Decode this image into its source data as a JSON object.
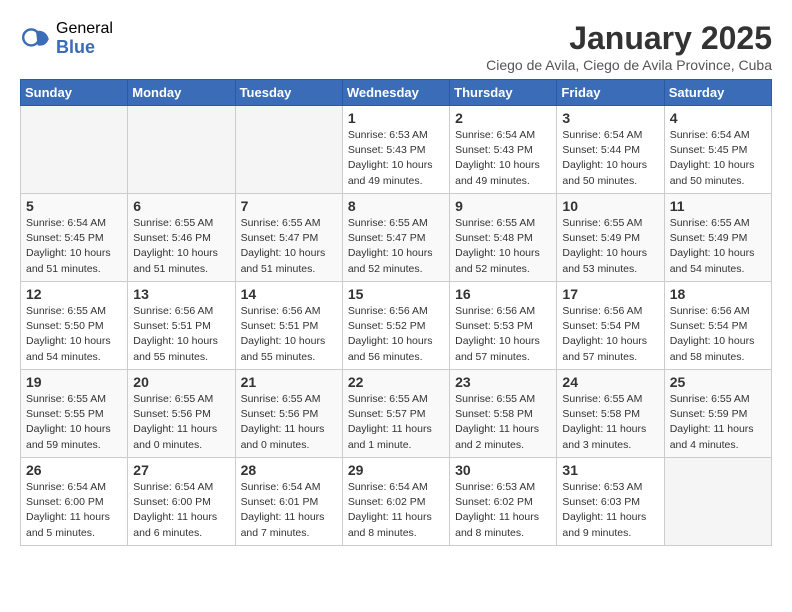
{
  "logo": {
    "general": "General",
    "blue": "Blue"
  },
  "header": {
    "title": "January 2025",
    "subtitle": "Ciego de Avila, Ciego de Avila Province, Cuba"
  },
  "days_of_week": [
    "Sunday",
    "Monday",
    "Tuesday",
    "Wednesday",
    "Thursday",
    "Friday",
    "Saturday"
  ],
  "weeks": [
    [
      {
        "day": "",
        "info": ""
      },
      {
        "day": "",
        "info": ""
      },
      {
        "day": "",
        "info": ""
      },
      {
        "day": "1",
        "info": "Sunrise: 6:53 AM\nSunset: 5:43 PM\nDaylight: 10 hours\nand 49 minutes."
      },
      {
        "day": "2",
        "info": "Sunrise: 6:54 AM\nSunset: 5:43 PM\nDaylight: 10 hours\nand 49 minutes."
      },
      {
        "day": "3",
        "info": "Sunrise: 6:54 AM\nSunset: 5:44 PM\nDaylight: 10 hours\nand 50 minutes."
      },
      {
        "day": "4",
        "info": "Sunrise: 6:54 AM\nSunset: 5:45 PM\nDaylight: 10 hours\nand 50 minutes."
      }
    ],
    [
      {
        "day": "5",
        "info": "Sunrise: 6:54 AM\nSunset: 5:45 PM\nDaylight: 10 hours\nand 51 minutes."
      },
      {
        "day": "6",
        "info": "Sunrise: 6:55 AM\nSunset: 5:46 PM\nDaylight: 10 hours\nand 51 minutes."
      },
      {
        "day": "7",
        "info": "Sunrise: 6:55 AM\nSunset: 5:47 PM\nDaylight: 10 hours\nand 51 minutes."
      },
      {
        "day": "8",
        "info": "Sunrise: 6:55 AM\nSunset: 5:47 PM\nDaylight: 10 hours\nand 52 minutes."
      },
      {
        "day": "9",
        "info": "Sunrise: 6:55 AM\nSunset: 5:48 PM\nDaylight: 10 hours\nand 52 minutes."
      },
      {
        "day": "10",
        "info": "Sunrise: 6:55 AM\nSunset: 5:49 PM\nDaylight: 10 hours\nand 53 minutes."
      },
      {
        "day": "11",
        "info": "Sunrise: 6:55 AM\nSunset: 5:49 PM\nDaylight: 10 hours\nand 54 minutes."
      }
    ],
    [
      {
        "day": "12",
        "info": "Sunrise: 6:55 AM\nSunset: 5:50 PM\nDaylight: 10 hours\nand 54 minutes."
      },
      {
        "day": "13",
        "info": "Sunrise: 6:56 AM\nSunset: 5:51 PM\nDaylight: 10 hours\nand 55 minutes."
      },
      {
        "day": "14",
        "info": "Sunrise: 6:56 AM\nSunset: 5:51 PM\nDaylight: 10 hours\nand 55 minutes."
      },
      {
        "day": "15",
        "info": "Sunrise: 6:56 AM\nSunset: 5:52 PM\nDaylight: 10 hours\nand 56 minutes."
      },
      {
        "day": "16",
        "info": "Sunrise: 6:56 AM\nSunset: 5:53 PM\nDaylight: 10 hours\nand 57 minutes."
      },
      {
        "day": "17",
        "info": "Sunrise: 6:56 AM\nSunset: 5:54 PM\nDaylight: 10 hours\nand 57 minutes."
      },
      {
        "day": "18",
        "info": "Sunrise: 6:56 AM\nSunset: 5:54 PM\nDaylight: 10 hours\nand 58 minutes."
      }
    ],
    [
      {
        "day": "19",
        "info": "Sunrise: 6:55 AM\nSunset: 5:55 PM\nDaylight: 10 hours\nand 59 minutes."
      },
      {
        "day": "20",
        "info": "Sunrise: 6:55 AM\nSunset: 5:56 PM\nDaylight: 11 hours\nand 0 minutes."
      },
      {
        "day": "21",
        "info": "Sunrise: 6:55 AM\nSunset: 5:56 PM\nDaylight: 11 hours\nand 0 minutes."
      },
      {
        "day": "22",
        "info": "Sunrise: 6:55 AM\nSunset: 5:57 PM\nDaylight: 11 hours\nand 1 minute."
      },
      {
        "day": "23",
        "info": "Sunrise: 6:55 AM\nSunset: 5:58 PM\nDaylight: 11 hours\nand 2 minutes."
      },
      {
        "day": "24",
        "info": "Sunrise: 6:55 AM\nSunset: 5:58 PM\nDaylight: 11 hours\nand 3 minutes."
      },
      {
        "day": "25",
        "info": "Sunrise: 6:55 AM\nSunset: 5:59 PM\nDaylight: 11 hours\nand 4 minutes."
      }
    ],
    [
      {
        "day": "26",
        "info": "Sunrise: 6:54 AM\nSunset: 6:00 PM\nDaylight: 11 hours\nand 5 minutes."
      },
      {
        "day": "27",
        "info": "Sunrise: 6:54 AM\nSunset: 6:00 PM\nDaylight: 11 hours\nand 6 minutes."
      },
      {
        "day": "28",
        "info": "Sunrise: 6:54 AM\nSunset: 6:01 PM\nDaylight: 11 hours\nand 7 minutes."
      },
      {
        "day": "29",
        "info": "Sunrise: 6:54 AM\nSunset: 6:02 PM\nDaylight: 11 hours\nand 8 minutes."
      },
      {
        "day": "30",
        "info": "Sunrise: 6:53 AM\nSunset: 6:02 PM\nDaylight: 11 hours\nand 8 minutes."
      },
      {
        "day": "31",
        "info": "Sunrise: 6:53 AM\nSunset: 6:03 PM\nDaylight: 11 hours\nand 9 minutes."
      },
      {
        "day": "",
        "info": ""
      }
    ]
  ]
}
